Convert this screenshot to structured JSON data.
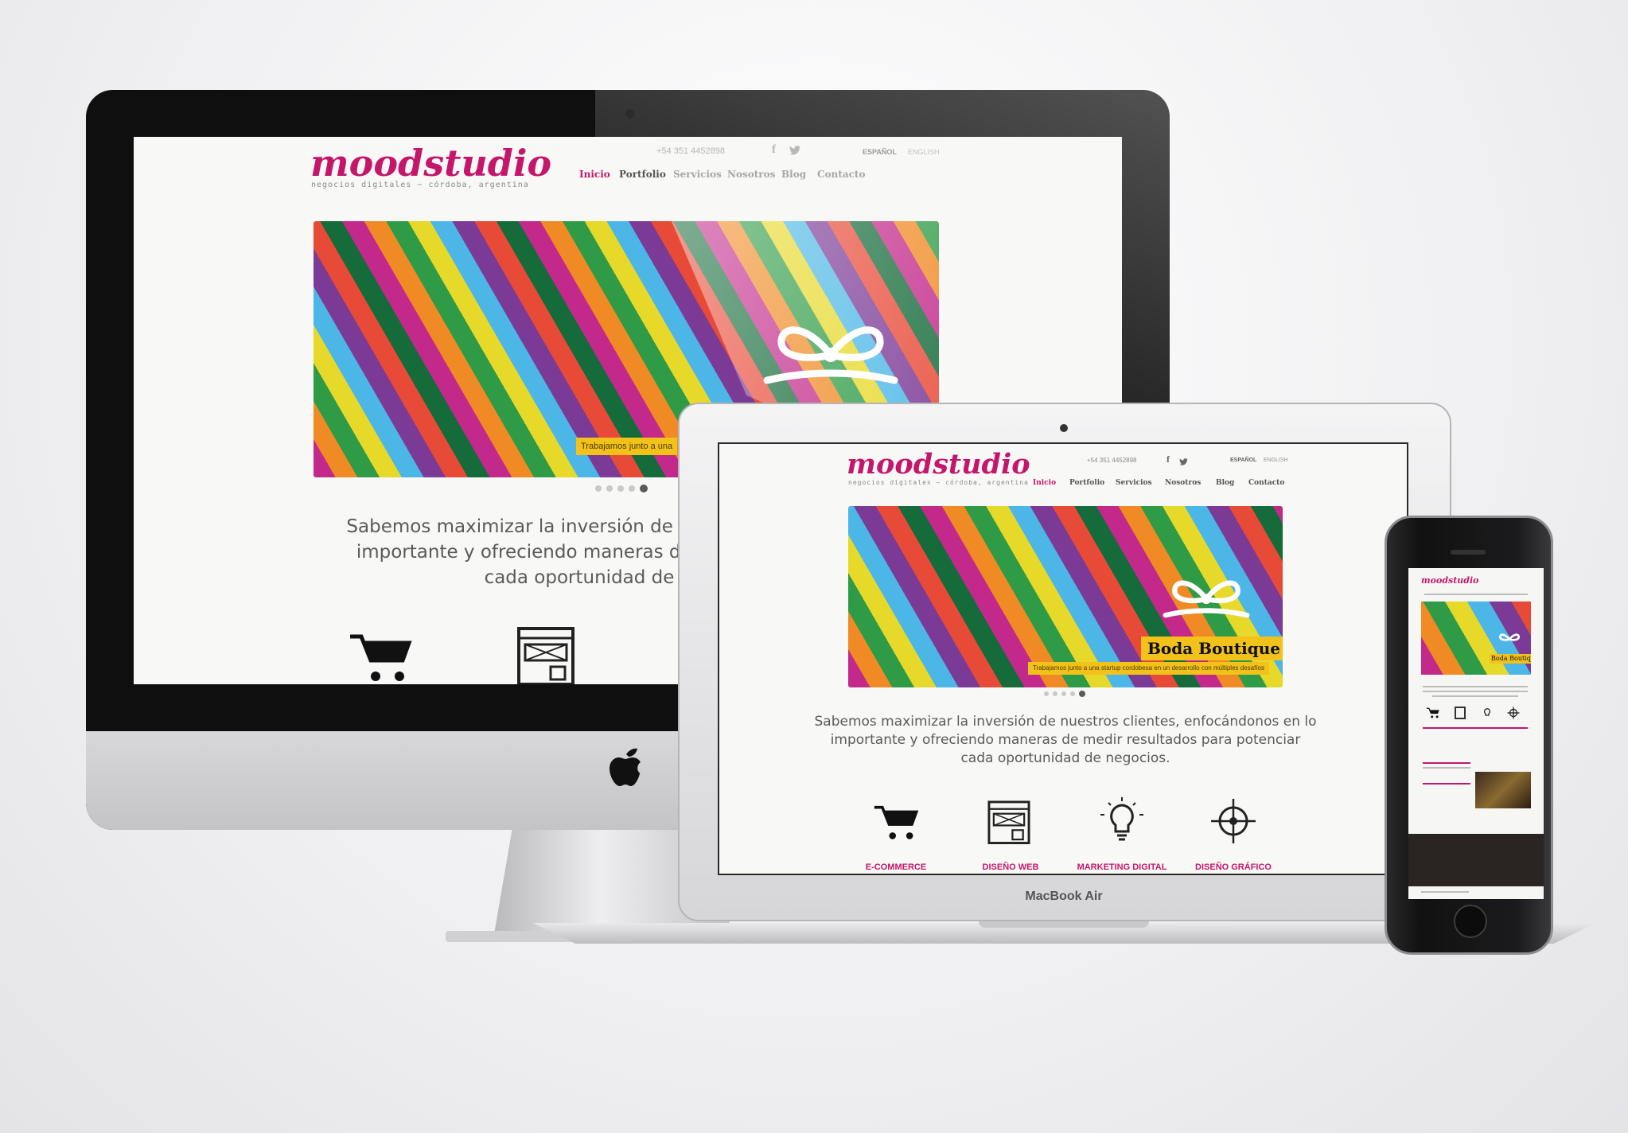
{
  "site": {
    "brand": "moodstudio",
    "tagline": "negocios digitales ~ córdoba, argentina",
    "phone": "+54 351 4452898",
    "languages": [
      "ESPAÑOL",
      "ENGLISH"
    ],
    "nav": [
      "Inicio",
      "Portfolio",
      "Servicios",
      "Nosotros",
      "Blog",
      "Contacto"
    ],
    "slide": {
      "title": "Boda Boutique",
      "caption": "Trabajamos junto a una startup cordobesa en un desarrollo con múltiples desafíos"
    },
    "intro_lines": [
      "Sabemos maximizar la inversión de nuestros clientes, enfocándonos en lo",
      "importante y ofreciendo maneras de medir resultados para potenciar",
      "cada oportunidad de negocios."
    ],
    "services": [
      "E-COMMERCE",
      "DISEÑO WEB",
      "MARKETING DIGITAL",
      "DISEÑO GRÁFICO"
    ],
    "slider_dot_count": 5,
    "slider_active_dot": 5
  },
  "imac": {
    "caption_visible": "Trabajamos junto a una",
    "intro_lines": [
      "Sabemos maximizar la inversión de nuestro",
      "importante y ofreciendo maneras de med",
      "cada oportunidad de"
    ]
  },
  "macbook": {
    "label": "MacBook Air"
  },
  "colors": {
    "brand": "#c4176b",
    "caption_bg": "#f2c21b"
  },
  "icons": [
    "facebook-icon",
    "twitter-icon",
    "cart-icon",
    "wireframe-icon",
    "lightbulb-icon",
    "crosshair-icon",
    "apple-logo-icon"
  ]
}
